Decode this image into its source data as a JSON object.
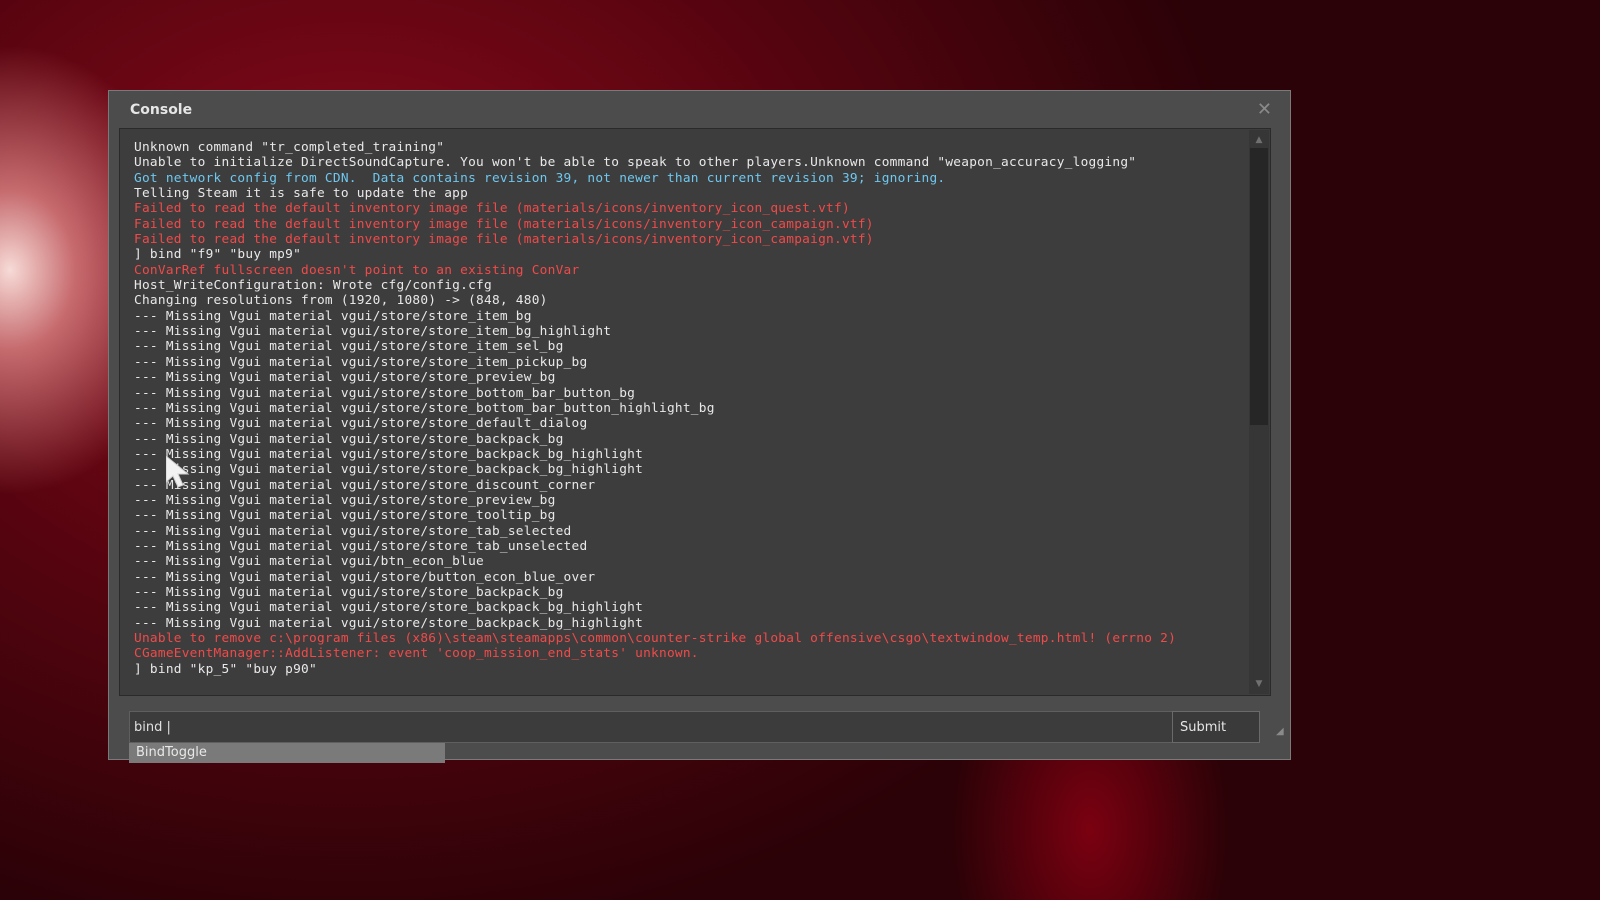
{
  "window": {
    "title": "Console",
    "close_glyph": "✕"
  },
  "log": [
    {
      "text": "Unknown command \"tr_completed_training\"",
      "type": "normal"
    },
    {
      "text": "Unable to initialize DirectSoundCapture. You won't be able to speak to other players.Unknown command \"weapon_accuracy_logging\"",
      "type": "normal"
    },
    {
      "text": "Got network config from CDN.  Data contains revision 39, not newer than current revision 39; ignoring.",
      "type": "info"
    },
    {
      "text": "Telling Steam it is safe to update the app",
      "type": "normal"
    },
    {
      "text": "Failed to read the default inventory image file (materials/icons/inventory_icon_quest.vtf)",
      "type": "error"
    },
    {
      "text": "Failed to read the default inventory image file (materials/icons/inventory_icon_campaign.vtf)",
      "type": "error"
    },
    {
      "text": "Failed to read the default inventory image file (materials/icons/inventory_icon_campaign.vtf)",
      "type": "error"
    },
    {
      "text": "] bind \"f9\" \"buy mp9\"",
      "type": "normal"
    },
    {
      "text": "ConVarRef fullscreen doesn't point to an existing ConVar",
      "type": "error"
    },
    {
      "text": "Host_WriteConfiguration: Wrote cfg/config.cfg",
      "type": "normal"
    },
    {
      "text": "Changing resolutions from (1920, 1080) -> (848, 480)",
      "type": "normal"
    },
    {
      "text": "--- Missing Vgui material vgui/store/store_item_bg",
      "type": "normal"
    },
    {
      "text": "--- Missing Vgui material vgui/store/store_item_bg_highlight",
      "type": "normal"
    },
    {
      "text": "--- Missing Vgui material vgui/store/store_item_sel_bg",
      "type": "normal"
    },
    {
      "text": "--- Missing Vgui material vgui/store/store_item_pickup_bg",
      "type": "normal"
    },
    {
      "text": "--- Missing Vgui material vgui/store/store_preview_bg",
      "type": "normal"
    },
    {
      "text": "--- Missing Vgui material vgui/store/store_bottom_bar_button_bg",
      "type": "normal"
    },
    {
      "text": "--- Missing Vgui material vgui/store/store_bottom_bar_button_highlight_bg",
      "type": "normal"
    },
    {
      "text": "--- Missing Vgui material vgui/store/store_default_dialog",
      "type": "normal"
    },
    {
      "text": "--- Missing Vgui material vgui/store/store_backpack_bg",
      "type": "normal"
    },
    {
      "text": "--- Missing Vgui material vgui/store/store_backpack_bg_highlight",
      "type": "normal"
    },
    {
      "text": "--- Missing Vgui material vgui/store/store_backpack_bg_highlight",
      "type": "normal"
    },
    {
      "text": "--- Missing Vgui material vgui/store/store_discount_corner",
      "type": "normal"
    },
    {
      "text": "--- Missing Vgui material vgui/store/store_preview_bg",
      "type": "normal"
    },
    {
      "text": "--- Missing Vgui material vgui/store/store_tooltip_bg",
      "type": "normal"
    },
    {
      "text": "--- Missing Vgui material vgui/store/store_tab_selected",
      "type": "normal"
    },
    {
      "text": "--- Missing Vgui material vgui/store/store_tab_unselected",
      "type": "normal"
    },
    {
      "text": "--- Missing Vgui material vgui/btn_econ_blue",
      "type": "normal"
    },
    {
      "text": "--- Missing Vgui material vgui/store/button_econ_blue_over",
      "type": "normal"
    },
    {
      "text": "--- Missing Vgui material vgui/store/store_backpack_bg",
      "type": "normal"
    },
    {
      "text": "--- Missing Vgui material vgui/store/store_backpack_bg_highlight",
      "type": "normal"
    },
    {
      "text": "--- Missing Vgui material vgui/store/store_backpack_bg_highlight",
      "type": "normal"
    },
    {
      "text": "Unable to remove c:\\program files (x86)\\steam\\steamapps\\common\\counter-strike global offensive\\csgo\\textwindow_temp.html! (errno 2)",
      "type": "error"
    },
    {
      "text": "CGameEventManager::AddListener: event 'coop_mission_end_stats' unknown.",
      "type": "error"
    },
    {
      "text": "] bind \"kp_5\" \"buy p90\"",
      "type": "normal"
    }
  ],
  "input": {
    "value": "bind |"
  },
  "submit_label": "Submit",
  "autocomplete": {
    "items": [
      "BindToggle"
    ]
  },
  "scrollbar": {
    "up_glyph": "▲",
    "down_glyph": "▼"
  },
  "resize_grip_glyph": "◢",
  "colors": {
    "normal_text": "#e8e8e8",
    "error_text": "#f04a4a",
    "info_text": "#6ec8f0",
    "window_bg": "#4c4c4c",
    "log_bg": "#3d3d3d"
  }
}
